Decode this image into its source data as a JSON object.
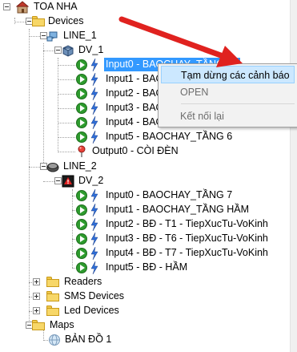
{
  "tree": {
    "root_label": "TOA NHA",
    "devices_label": "Devices",
    "line1": {
      "label": "LINE_1",
      "dv_label": "DV_1",
      "inputs": [
        "Input0 - BAOCHAY_TẦNG 1",
        "Input1 - BAOCHAY_TẦNG 2",
        "Input2 - BAOCHAY_TẦNG 3",
        "Input3 - BAOCHAY_TẦNG 4",
        "Input4 - BAOCHAY_TẦNG 5",
        "Input5 - BAOCHAY_TẦNG 6"
      ],
      "output_label": "Output0 - CÒI ĐÈN"
    },
    "line2": {
      "label": "LINE_2",
      "dv_label": "DV_2",
      "inputs": [
        "Input0 - BAOCHAY_TẦNG 7",
        "Input1 - BAOCHAY_TẦNG HẦM",
        "Input2 - BĐ - T1 - TiepXucTu-VoKinh",
        "Input3 - BĐ - T6 - TiepXucTu-VoKinh",
        "Input4 - BĐ - T7 - TiepXucTu-VoKinh",
        "Input5 - BĐ - HẦM"
      ]
    },
    "readers_label": "Readers",
    "sms_label": "SMS Devices",
    "led_label": "Led Devices",
    "maps_label": "Maps",
    "map1_label": "BẢN ĐỒ 1"
  },
  "context_menu": {
    "items": [
      "Tạm dừng các cảnh báo",
      "OPEN",
      "Kết nối lại"
    ],
    "highlighted_index": 0
  },
  "colors": {
    "selection": "#3399ff",
    "menu_highlight": "#cce8ff",
    "arrow": "#e0221f"
  }
}
